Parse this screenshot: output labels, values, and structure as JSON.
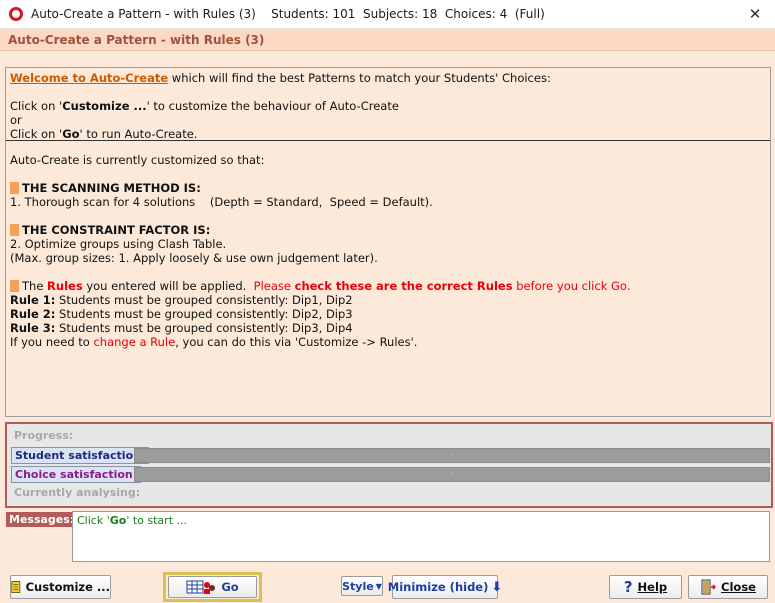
{
  "window": {
    "title": "Auto-Create a Pattern - with Rules (3)    Students: 101  Subjects: 18  Choices: 4  (Full)",
    "header": "Auto-Create a Pattern - with Rules (3)"
  },
  "info": {
    "welcome_link": "Welcome to Auto-Create",
    "welcome_rest": " which will find the best Patterns to match your Students' Choices:",
    "customize_pre": "Click on '",
    "customize_b": "Customize ...",
    "customize_post": "' to customize the behaviour of Auto-Create",
    "or": "or",
    "go_pre": "Click on '",
    "go_b": "Go",
    "go_post": "' to run Auto-Create.",
    "customized_intro": "Auto-Create is currently customized so that:",
    "scan_heading": "THE SCANNING METHOD IS:",
    "scan_line": "1. Thorough scan for 4 solutions    (Depth = Standard,  Speed = Default).",
    "constraint_heading": "THE CONSTRAINT FACTOR IS:",
    "constraint_line1": "2. Optimize groups using Clash Table.",
    "constraint_line2": "(Max. group sizes: 1. Apply loosely & use own judgement later).",
    "rules_the": "The ",
    "rules_word": "Rules",
    "rules_mid": " you entered will be applied.  ",
    "rules_please": "Please ",
    "rules_check": "check these are the correct Rules",
    "rules_before": " before you click Go.",
    "rules": [
      {
        "label": "Rule 1:",
        "text": " Students must be grouped consistently:  Dip1, Dip2"
      },
      {
        "label": "Rule 2:",
        "text": " Students must be grouped consistently:  Dip2, Dip3"
      },
      {
        "label": "Rule 3:",
        "text": " Students must be grouped consistently:  Dip3, Dip4"
      }
    ],
    "change_pre": "If you need to ",
    "change_link": "change a Rule",
    "change_post": ", you can do this via 'Customize -> Rules'."
  },
  "progress": {
    "progress_label": "Progress:",
    "student_btn": "Student satisfaction:",
    "choice_btn": "Choice satisfaction:",
    "student_marker": "-",
    "choice_marker": "-",
    "analysing_label": "Currently analysing:"
  },
  "messages": {
    "label": "Messages:",
    "text_pre": "Click '",
    "text_b": "Go",
    "text_post": "' to start ..."
  },
  "buttons": {
    "customize": "Customize ...",
    "go": "Go",
    "style": "Style",
    "minimize": "Minimize (hide)",
    "help": "Help",
    "close": "Close"
  },
  "colors": {
    "background": "#fde9d9",
    "header_text": "#a0523d",
    "accent_red": "#e8000b",
    "marker_orange": "#f4a15a",
    "button_blue": "#1c3fa0",
    "student_label": "#1b2a80",
    "choice_label": "#8b1a8b"
  }
}
